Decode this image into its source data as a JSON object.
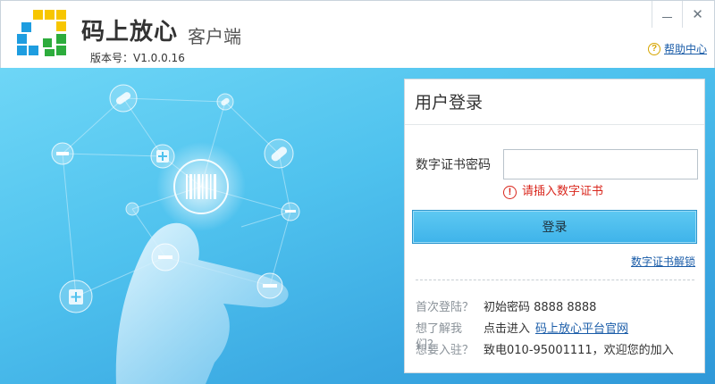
{
  "header": {
    "app_title": "码上放心",
    "app_subtitle": "客户端",
    "version": "版本号：V1.0.0.16",
    "help_label": "帮助中心",
    "help_icon": "?"
  },
  "window_controls": {
    "close_glyph": "✕"
  },
  "colors": {
    "logo_yellow": "#f7c600",
    "logo_green": "#2dac3c",
    "logo_blue": "#1e9de0",
    "button_blue": "#3eb3ea",
    "error_red": "#d9261c",
    "link_blue": "#1a5ca8"
  },
  "hero": {
    "barcode_icon": "barcode-icon",
    "node_icons": [
      "pill-icon",
      "medicine-kit-icon",
      "tablet-icon",
      "minus-circle-icon"
    ]
  },
  "login": {
    "title": "用户登录",
    "password_label": "数字证书密码",
    "password_value": "",
    "error_icon": "!",
    "error_text": "请插入数字证书",
    "submit_label": "登录",
    "unlock_link": "数字证书解锁"
  },
  "info": {
    "first_login_q": "首次登陆？",
    "first_login_a": "初始密码 8888 8888",
    "learn_q": "想了解我们？",
    "learn_a": "点击进入",
    "learn_link": "码上放心平台官网",
    "join_q": "想要入驻？",
    "join_a": "致电010-95001111，欢迎您的加入"
  }
}
